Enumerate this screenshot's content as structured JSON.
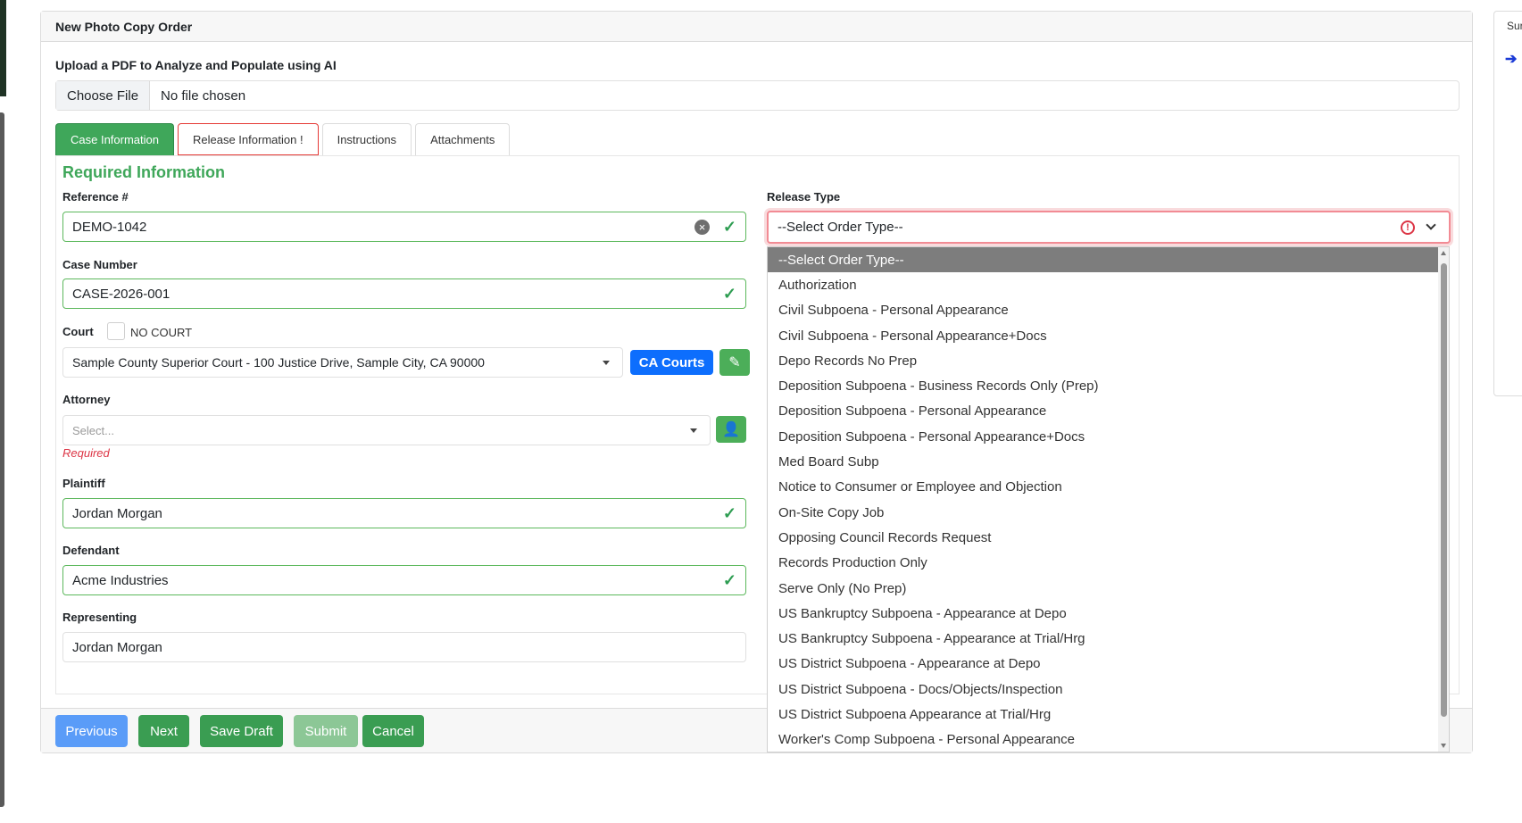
{
  "card": {
    "title": "New Photo Copy Order",
    "upload_label": "Upload a PDF to Analyze and Populate using AI",
    "file_button": "Choose File",
    "file_status": "No file chosen"
  },
  "tabs": [
    {
      "label": "Case Information",
      "state": "active"
    },
    {
      "label": "Release Information !",
      "state": "error"
    },
    {
      "label": "Instructions",
      "state": "normal"
    },
    {
      "label": "Attachments",
      "state": "normal"
    }
  ],
  "form": {
    "section_title": "Required Information",
    "reference": {
      "label": "Reference #",
      "value": "DEMO-1042"
    },
    "case_number": {
      "label": "Case Number",
      "value": "CASE-2026-001"
    },
    "court": {
      "label": "Court",
      "no_court_label": "NO COURT",
      "value": "Sample County Superior Court - 100 Justice Drive, Sample City, CA 90000",
      "ca_courts_button": "CA Courts"
    },
    "attorney": {
      "label": "Attorney",
      "placeholder": "Select...",
      "error": "Required"
    },
    "plaintiff": {
      "label": "Plaintiff",
      "value": "Jordan Morgan"
    },
    "defendant": {
      "label": "Defendant",
      "value": "Acme Industries"
    },
    "representing": {
      "label": "Representing",
      "value": "Jordan Morgan"
    }
  },
  "release": {
    "label": "Release Type",
    "selected": "--Select Order Type--",
    "options": [
      "--Select Order Type--",
      "Authorization",
      "Civil Subpoena - Personal Appearance",
      "Civil Subpoena - Personal Appearance+Docs",
      "Depo Records No Prep",
      "Deposition Subpoena - Business Records Only (Prep)",
      "Deposition Subpoena - Personal Appearance",
      "Deposition Subpoena - Personal Appearance+Docs",
      "Med Board Subp",
      "Notice to Consumer or Employee and Objection",
      "On-Site Copy Job",
      "Opposing Council Records Request",
      "Records Production Only",
      "Serve Only (No Prep)",
      "US Bankruptcy Subpoena - Appearance at Depo",
      "US Bankruptcy Subpoena - Appearance at Trial/Hrg",
      "US District Subpoena - Appearance at Depo",
      "US District Subpoena - Docs/Objects/Inspection",
      "US District Subpoena Appearance at Trial/Hrg",
      "Worker's Comp Subpoena - Personal Appearance"
    ]
  },
  "footer": {
    "previous": "Previous",
    "next": "Next",
    "save_draft": "Save Draft",
    "submit": "Submit",
    "cancel": "Cancel"
  },
  "side": {
    "title": "Sur",
    "arrow": "➔"
  },
  "icons": {
    "clear": "clear-icon",
    "check": "checkmark-icon",
    "edit": "pencil-icon",
    "add_attorney": "user-edit-icon",
    "warning": "exclamation-circle-icon"
  },
  "colors": {
    "success": "#3fa75a",
    "primary": "#0d6efd",
    "danger": "#dc3545",
    "previous": "#5a9cf8",
    "submit_disabled": "#8cc796"
  }
}
